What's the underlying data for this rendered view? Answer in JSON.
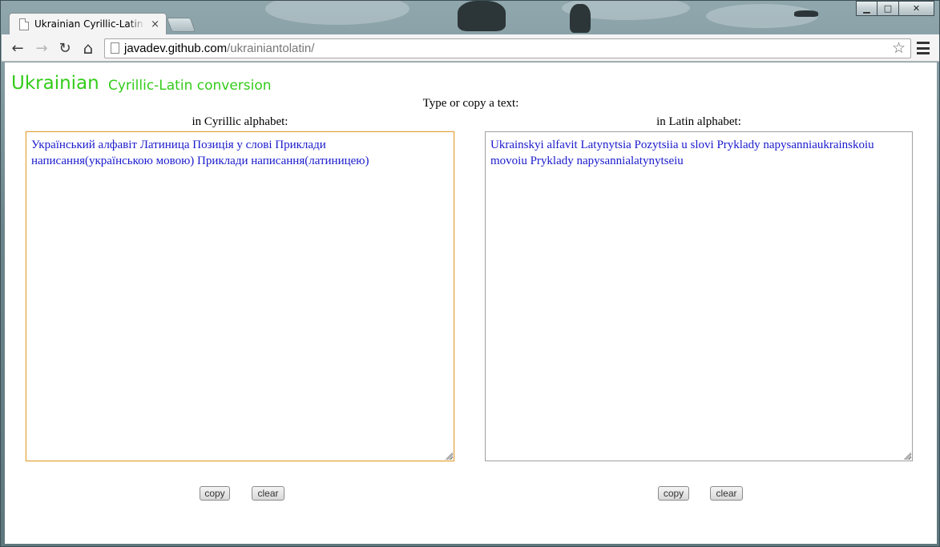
{
  "window": {
    "caption_buttons": [
      "minimize",
      "maximize",
      "close"
    ]
  },
  "tab": {
    "title": "Ukrainian Cyrillic-Latin conversion",
    "close_glyph": "×"
  },
  "toolbar": {
    "back_icon": "←",
    "forward_icon": "→",
    "reload_icon": "↻",
    "home_icon": "⌂",
    "url_host": "javadev.github.com",
    "url_path": "/ukrainiantolatin/",
    "star_icon": "☆"
  },
  "page": {
    "title_main": "Ukrainian",
    "title_sub": "Cyrillic-Latin conversion",
    "instruction": "Type or copy a text:",
    "cyrillic": {
      "label": "in Cyrillic alphabet:",
      "text": "Український алфавіт Латиница Позиція у слові Приклади написання(українською мовою) Приклади написання(латиницею)",
      "copy_label": "copy",
      "clear_label": "clear"
    },
    "latin": {
      "label": "in Latin alphabet:",
      "text": "Ukrainskyi alfavit Latynytsia Pozytsiia u slovi Pryklady napysanniaukrainskoiu movoiu Pryklady napysannialatynytseiu",
      "copy_label": "copy",
      "clear_label": "clear"
    }
  },
  "colors": {
    "title_green": "#33cc1a",
    "textarea_text": "#1a1acc",
    "focus_border": "#e2a33a"
  }
}
